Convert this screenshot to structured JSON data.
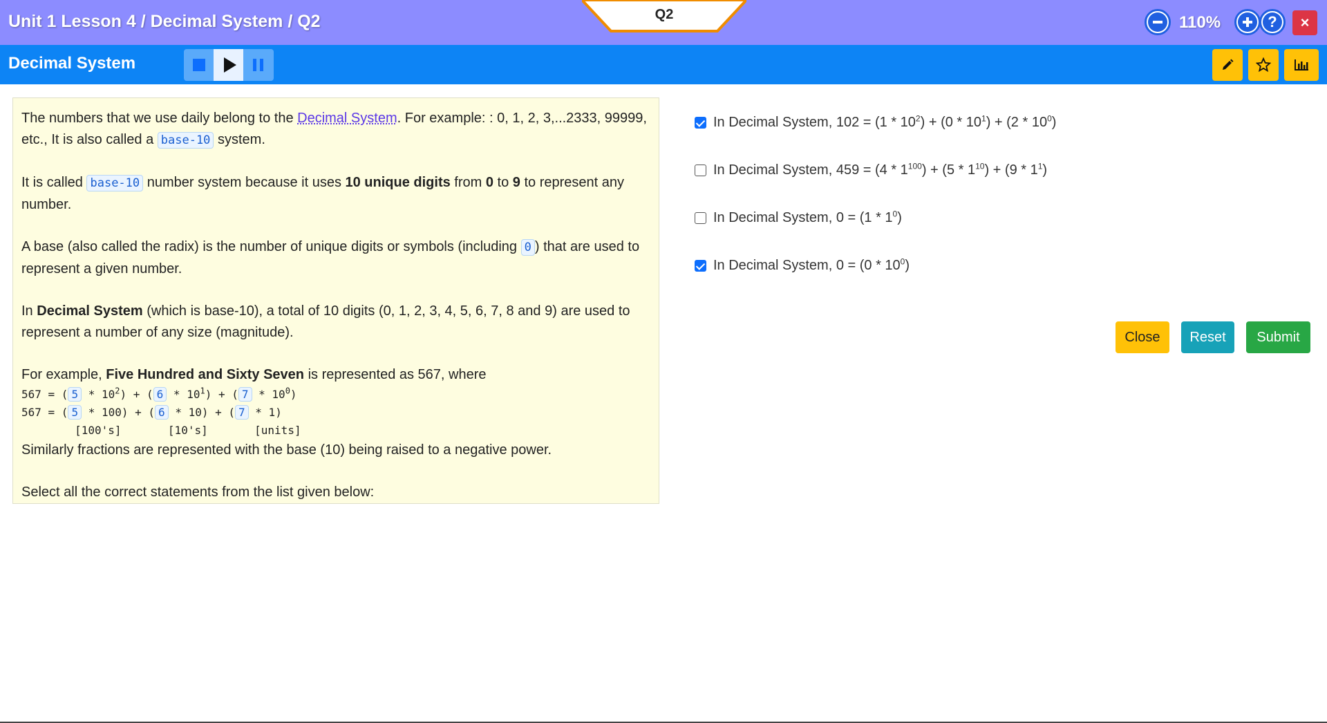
{
  "header": {
    "breadcrumb": "Unit 1 Lesson 4 / Decimal System / Q2",
    "question_tab": "Q2",
    "zoom": "110%",
    "zoom_out_icon": "minus-circle-icon",
    "zoom_in_icon": "plus-circle-icon",
    "help_symbol": "?",
    "close_symbol": "×"
  },
  "toolbar": {
    "title": "Decimal System",
    "media": [
      "stop-icon",
      "play-icon",
      "pause-icon"
    ],
    "tools": [
      "pencil-icon",
      "star-icon",
      "bar-chart-icon"
    ]
  },
  "content": {
    "p1_a": "The numbers that we use daily belong to the ",
    "p1_link": "Decimal System",
    "p1_b": ". For example: : 0, 1, 2, 3,...2333, 99999, etc., It is also called a ",
    "p1_code": "base-10",
    "p1_c": " system.",
    "p2_a": "It is called ",
    "p2_code": "base-10",
    "p2_b": " number system because it uses ",
    "p2_bold1": "10 unique digits",
    "p2_c": " from ",
    "p2_bold2": "0",
    "p2_d": " to ",
    "p2_bold3": "9",
    "p2_e": " to represent any number.",
    "p3_a": "A base (also called the radix) is the number of unique digits or symbols (including ",
    "p3_code": "0",
    "p3_b": ") that are used to represent a given number.",
    "p4_a": "In ",
    "p4_bold": "Decimal System",
    "p4_b": " (which is base-10), a total of 10 digits (0, 1, 2, 3, 4, 5, 6, 7, 8 and 9) are used to represent a number of any size (magnitude).",
    "p5_a": "For example, ",
    "p5_bold": "Five Hundred and Sixty Seven",
    "p5_b": " is represented as 567, where",
    "eq1_prefix": "567 = (",
    "eq1_d1": "5",
    "eq1_m1": " * 10",
    "eq1_e1": "2",
    "eq1_m2": ") + (",
    "eq1_d2": "6",
    "eq1_m3": " * 10",
    "eq1_e2": "1",
    "eq1_m4": ") + (",
    "eq1_d3": "7",
    "eq1_m5": " * 10",
    "eq1_e3": "0",
    "eq1_end": ")",
    "eq2_prefix": "567 = (",
    "eq2_d1": "5",
    "eq2_m1": " * 100) + (",
    "eq2_d2": "6",
    "eq2_m2": " * 10) + (",
    "eq2_d3": "7",
    "eq2_end": " * 1)",
    "eq3": "        [100's]       [10's]       [units]",
    "p6": "Similarly fractions are represented with the base (10) being raised to a negative power.",
    "p7": "Select all the correct statements from the list given below:"
  },
  "options": [
    {
      "checked": true,
      "text": "In Decimal System, 102 = (1 * 10",
      "e1": "2",
      "m1": ") + (0 * 10",
      "e2": "1",
      "m2": ") + (2 * 10",
      "e3": "0",
      "end": ")"
    },
    {
      "checked": false,
      "text": "In Decimal System, 459 = (4 * 1",
      "e1": "100",
      "m1": ") + (5 * 1",
      "e2": "10",
      "m2": ") + (9 * 1",
      "e3": "1",
      "end": ")"
    },
    {
      "checked": false,
      "text": "In Decimal System, 0 = (1 * 1",
      "e1": "0",
      "end": ")"
    },
    {
      "checked": true,
      "text": "In Decimal System, 0 = (0 * 10",
      "e1": "0",
      "end": ")"
    }
  ],
  "actions": {
    "close": "Close",
    "reset": "Reset",
    "submit": "Submit"
  },
  "colors": {
    "topbar": "#8c8cff",
    "titlebar": "#0d84f5",
    "panel": "#fefde0",
    "close_btn": "#ffc107",
    "reset_btn": "#17a2b8",
    "submit_btn": "#28a745",
    "tab_border": "#f08c00"
  }
}
